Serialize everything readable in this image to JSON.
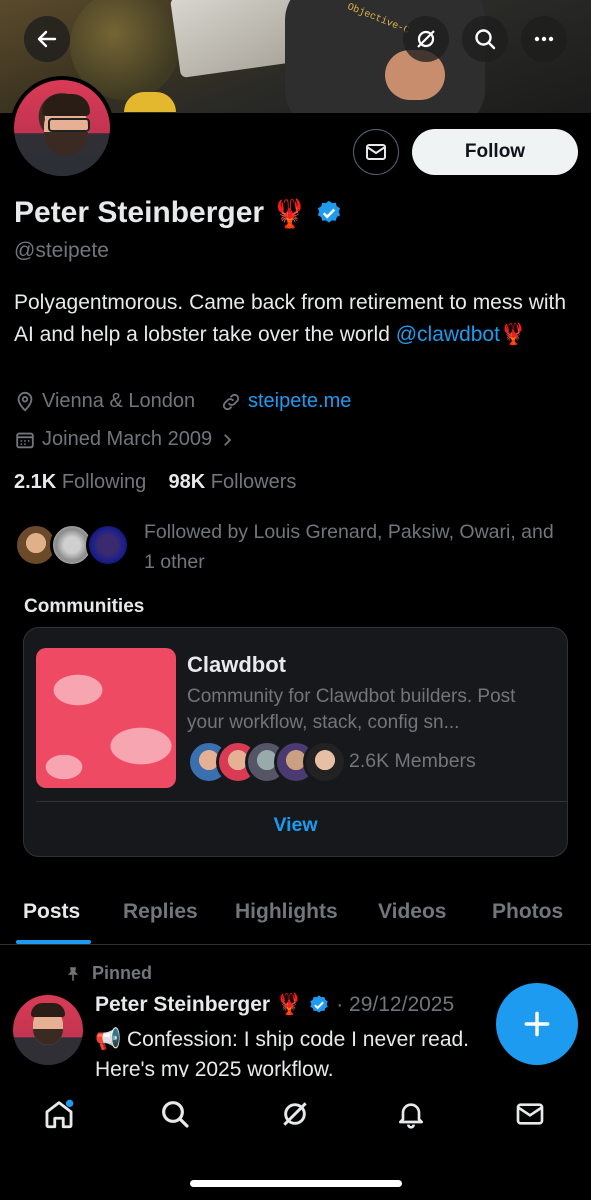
{
  "header": {
    "back_icon": "arrow-left-icon",
    "grok_icon": "grok-icon",
    "search_icon": "search-icon",
    "more_icon": "more-horizontal-icon",
    "banner_shirt_text": "Objective-C"
  },
  "profile": {
    "name": "Peter Steinberger",
    "name_emoji": "🦞",
    "verified": true,
    "handle": "@steipete",
    "bio_text": "Polyagentmorous. Came back from retirement to mess with AI and help a lobster take over the world ",
    "bio_mention": "@clawdbot",
    "bio_emoji": "🦞",
    "location": "Vienna & London",
    "website": "steipete.me",
    "joined": "Joined March 2009",
    "following_count": "2.1K",
    "following_label": "Following",
    "followers_count": "98K",
    "followers_label": "Followers",
    "followed_by": "Followed by Louis Grenard, Paksiw, Owari, and 1 other",
    "follow_label": "Follow"
  },
  "communities": {
    "heading": "Communities",
    "items": [
      {
        "title": "Clawdbot",
        "description": "Community for Clawdbot builders. Post your workflow, stack, config sn...",
        "members": "2.6K Members",
        "view_label": "View"
      }
    ]
  },
  "tabs": [
    {
      "label": "Posts",
      "active": true
    },
    {
      "label": "Replies",
      "active": false
    },
    {
      "label": "Highlights",
      "active": false
    },
    {
      "label": "Videos",
      "active": false
    },
    {
      "label": "Photos",
      "active": false
    }
  ],
  "pinned_post": {
    "pinned_label": "Pinned",
    "author": "Peter Steinberger",
    "author_emoji": "🦞",
    "date": "· 29/12/2025",
    "line1": "📢 Confession: I ship code I never read.",
    "line2": "Here's my 2025 workflow."
  },
  "fab_icon": "plus-icon",
  "bottom_nav": [
    "home-icon",
    "search-icon",
    "grok-icon",
    "notifications-icon",
    "messages-icon"
  ],
  "colors": {
    "accent": "#1d9bf0",
    "background": "#000000",
    "secondary_text": "#71767b"
  }
}
